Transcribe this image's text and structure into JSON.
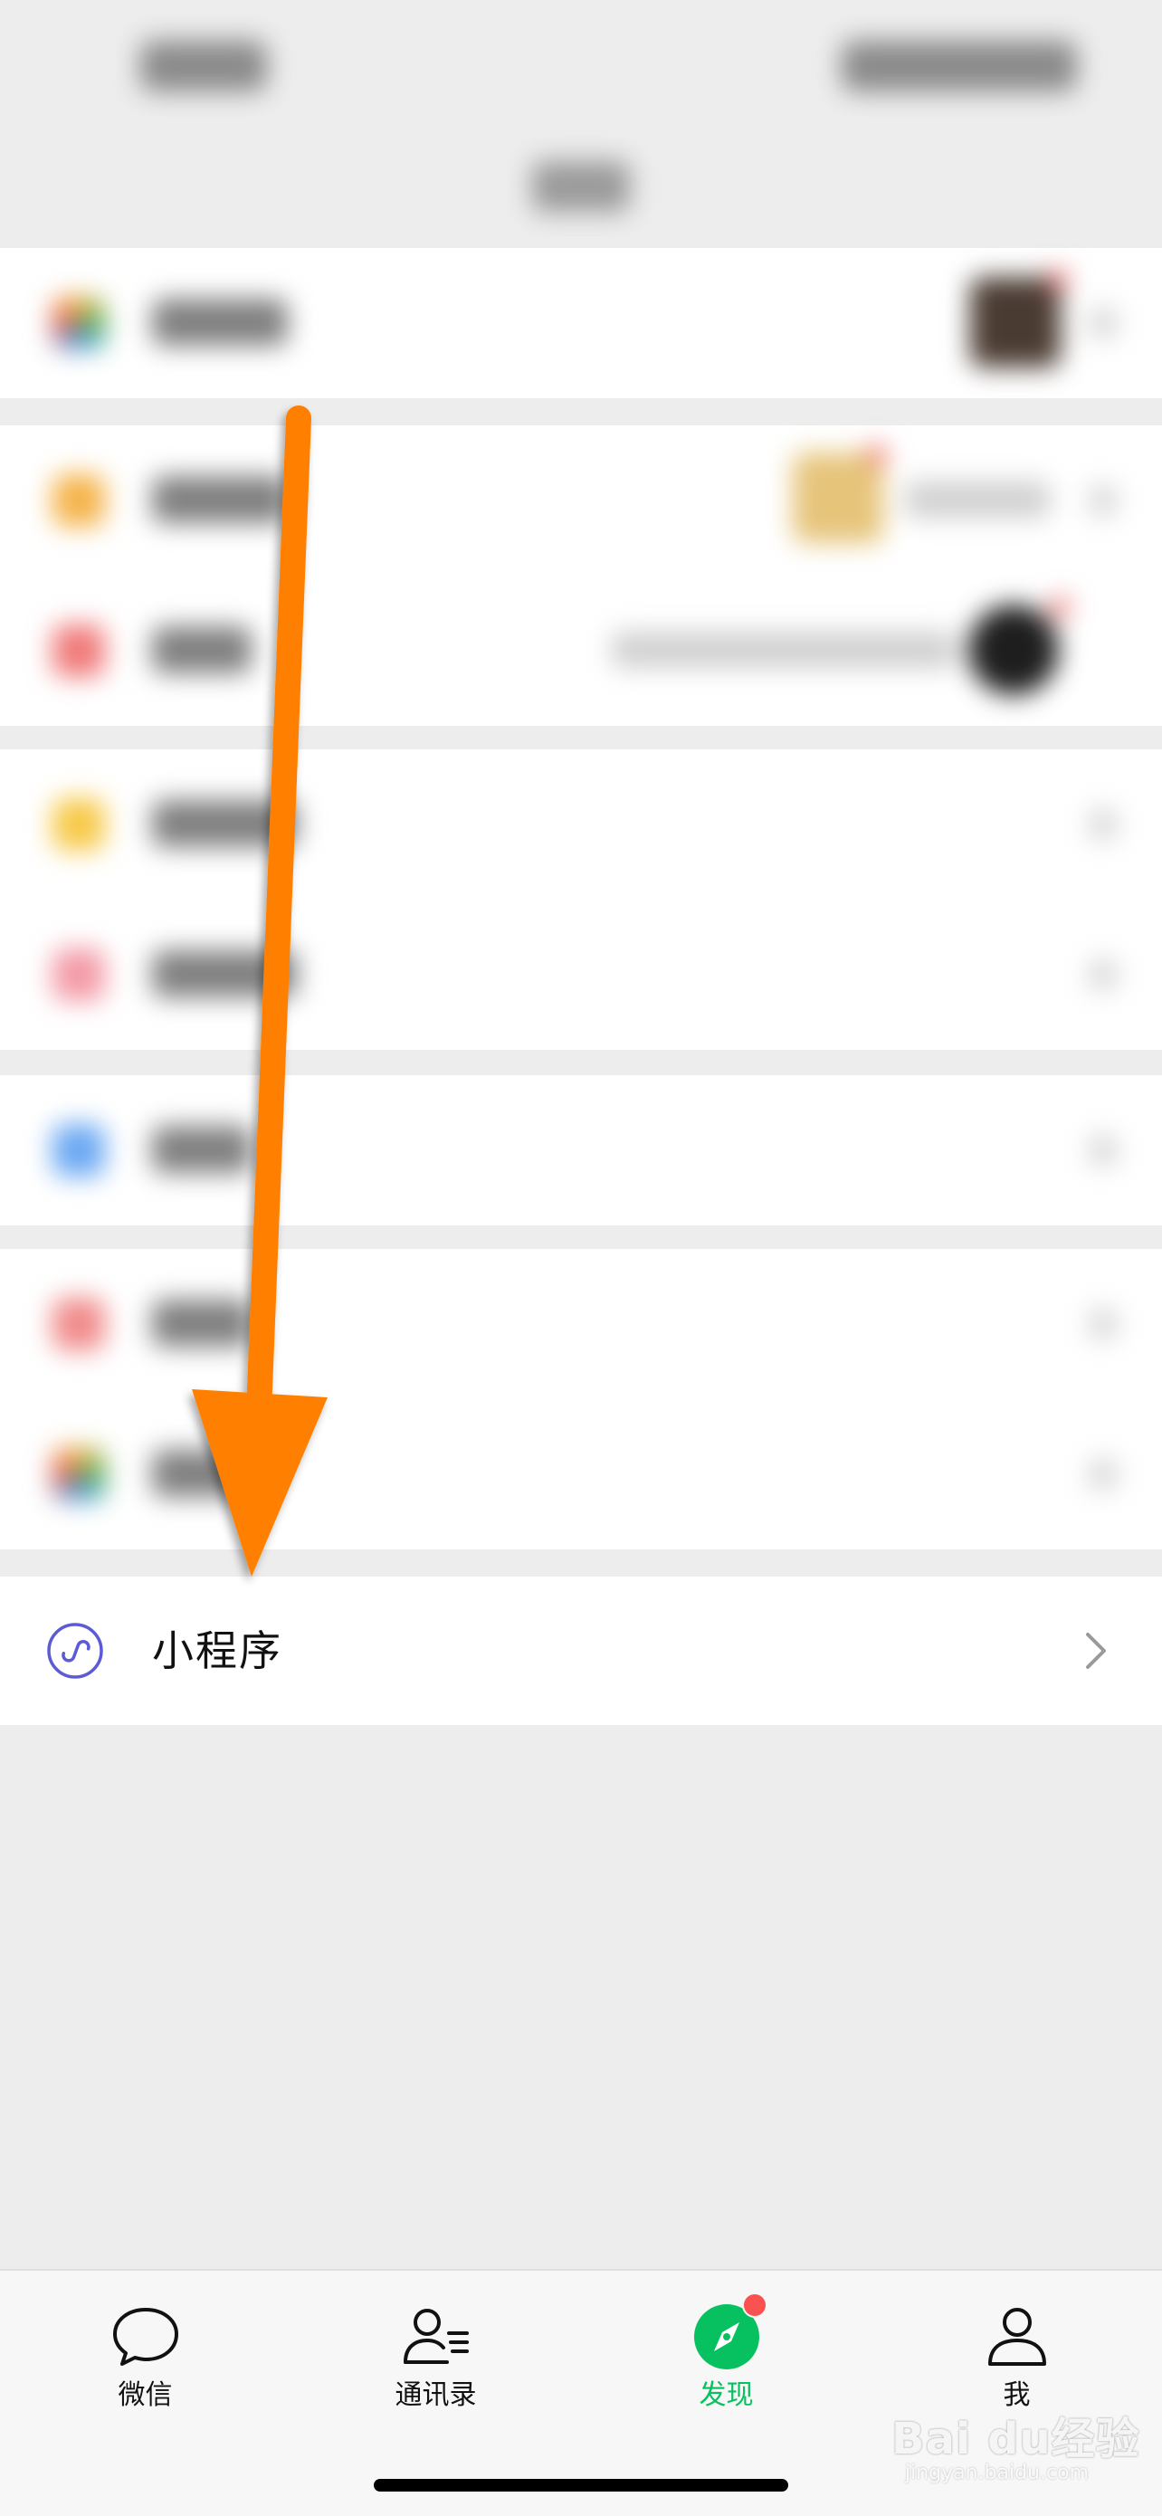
{
  "mini_program": {
    "label": "小程序",
    "icon": "mini-program-icon",
    "chevron": "chevron-right-icon"
  },
  "tabbar": {
    "tabs": [
      {
        "label": "微信",
        "icon": "chat-bubble-icon",
        "active": false
      },
      {
        "label": "通讯录",
        "icon": "contacts-icon",
        "active": false
      },
      {
        "label": "发现",
        "icon": "compass-icon",
        "active": true,
        "badge": true
      },
      {
        "label": "我",
        "icon": "person-icon",
        "active": false
      }
    ]
  },
  "watermark": {
    "brand": "Bai du经验",
    "url": "jingyan.baidu.com"
  },
  "colors": {
    "accent_green": "#07c160",
    "badge_red": "#fa5151",
    "annotation_orange": "#ff8000",
    "mini_program_purple": "#5b5bd6"
  }
}
